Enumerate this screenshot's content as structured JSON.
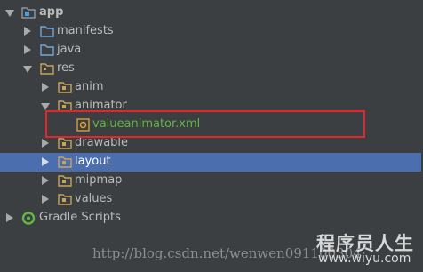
{
  "tree": {
    "app": "app",
    "manifests": "manifests",
    "java": "java",
    "res": "res",
    "anim": "anim",
    "animator": "animator",
    "valueanimator": "valueanimator.xml",
    "drawable": "drawable",
    "layout": "layout",
    "mipmap": "mipmap",
    "values": "values",
    "gradle_scripts": "Gradle Scripts"
  },
  "colors": {
    "background": "#3c3f41",
    "selection": "#4b6eaf",
    "xml_file_text": "#62b543",
    "highlight_box": "#e2262a"
  },
  "watermark": {
    "url": "http://blog.csdn.net/wenwen091100304",
    "brand": "程序员人生",
    "site": "www.wiyu.com"
  }
}
